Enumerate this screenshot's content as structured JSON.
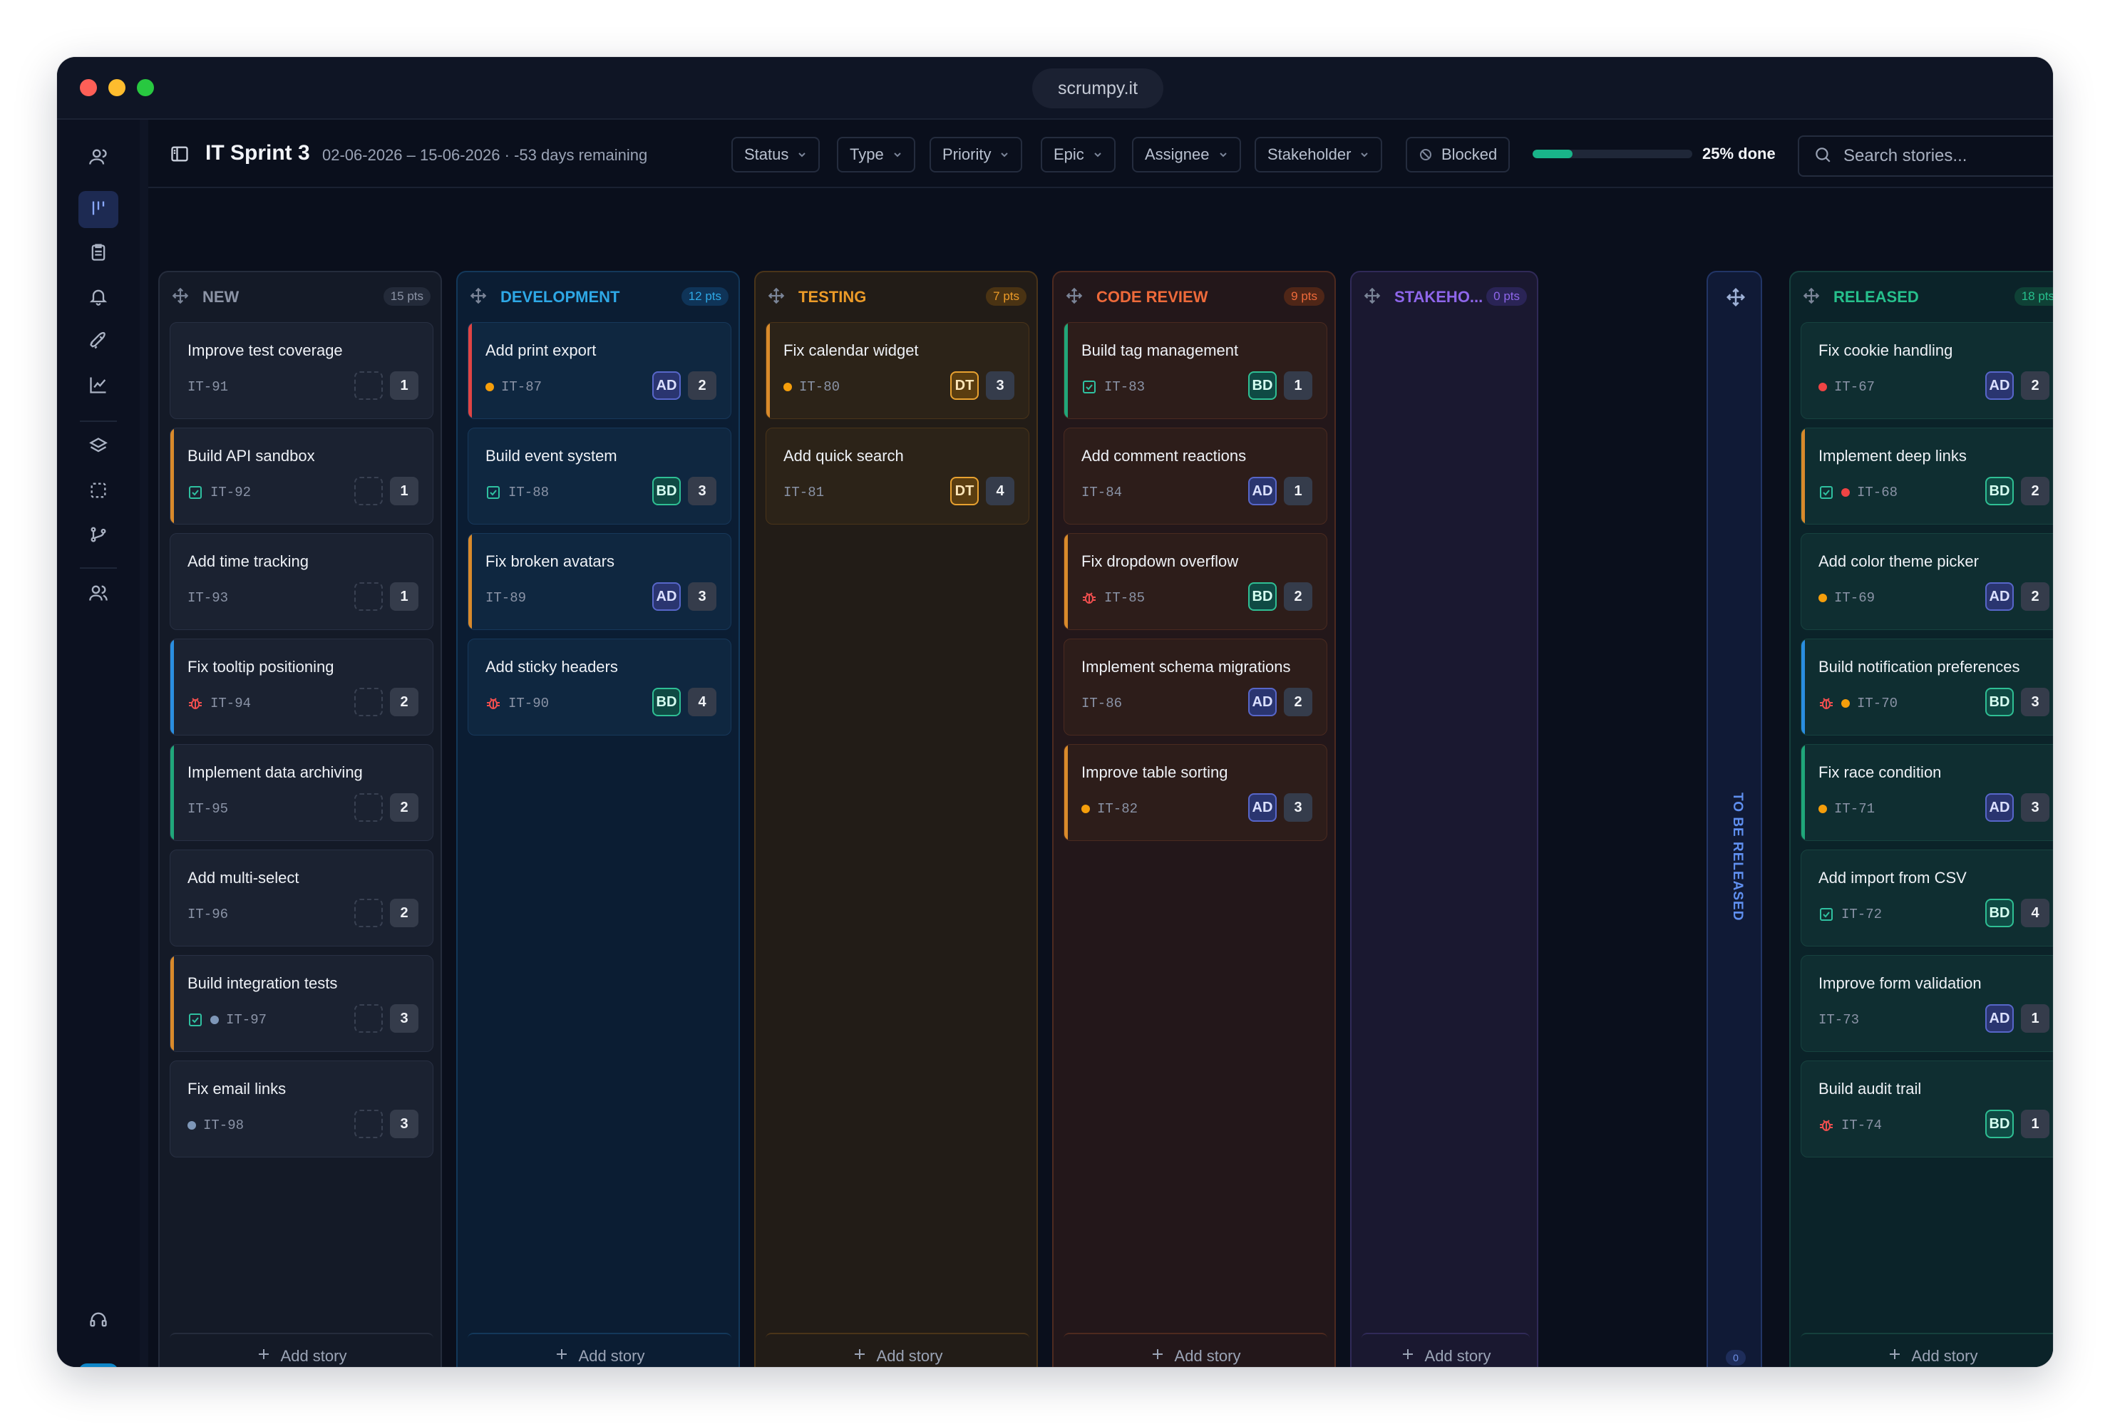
{
  "window": {
    "url": "scrumpy.it"
  },
  "user": {
    "initials": "AD"
  },
  "header": {
    "sprint_title": "IT Sprint 3",
    "sprint_dates": "02-06-2026 – 15-06-2026 · -53 days remaining",
    "filters": [
      "Status",
      "Type",
      "Priority",
      "Epic",
      "Assignee",
      "Stakeholder"
    ],
    "blocked_label": "Blocked",
    "progress_fraction": 0.25,
    "progress_label": "25% done",
    "search_placeholder": "Search stories..."
  },
  "add_story_label": "Add story",
  "colors": {
    "new": "#8b93a5",
    "development": "#2ea8e6",
    "testing": "#ec9b28",
    "code_review": "#ee6a3a",
    "stakeholder": "#8e66ea",
    "released": "#26c08c",
    "assignee_ad": "#6f7fe8",
    "assignee_bd": "#2fbf94",
    "assignee_dt": "#f0a52d",
    "priority_high": "#ef4444",
    "priority_medium": "#f59e0b",
    "priority_low": "#7e97b8"
  },
  "release_strip": {
    "label": "TO BE RELEASED",
    "count": "0"
  },
  "columns": [
    {
      "title": "NEW",
      "points": "15 pts",
      "cards": [
        {
          "title": "Improve test coverage",
          "id": "IT-91",
          "points": "1",
          "icon": "none",
          "priority": "none",
          "assignee": "",
          "accent": "none"
        },
        {
          "title": "Build API sandbox",
          "id": "IT-92",
          "points": "1",
          "icon": "task-icon",
          "priority": "none",
          "assignee": "",
          "accent": "orange"
        },
        {
          "title": "Add time tracking",
          "id": "IT-93",
          "points": "1",
          "icon": "none",
          "priority": "none",
          "assignee": "",
          "accent": "none"
        },
        {
          "title": "Fix tooltip positioning",
          "id": "IT-94",
          "points": "2",
          "icon": "bug-icon",
          "priority": "none",
          "assignee": "",
          "accent": "blue"
        },
        {
          "title": "Implement data archiving",
          "id": "IT-95",
          "points": "2",
          "icon": "none",
          "priority": "none",
          "assignee": "",
          "accent": "green"
        },
        {
          "title": "Add multi-select",
          "id": "IT-96",
          "points": "2",
          "icon": "none",
          "priority": "none",
          "assignee": "",
          "accent": "none"
        },
        {
          "title": "Build integration tests",
          "id": "IT-97",
          "points": "3",
          "icon": "task-icon",
          "priority": "low",
          "assignee": "",
          "accent": "orange"
        },
        {
          "title": "Fix email links",
          "id": "IT-98",
          "points": "3",
          "icon": "none",
          "priority": "low",
          "assignee": "",
          "accent": "none"
        }
      ]
    },
    {
      "title": "DEVELOPMENT",
      "points": "12 pts",
      "cards": [
        {
          "title": "Add print export",
          "id": "IT-87",
          "points": "2",
          "icon": "none",
          "priority": "medium",
          "assignee": "AD",
          "accent": "red"
        },
        {
          "title": "Build event system",
          "id": "IT-88",
          "points": "3",
          "icon": "task-icon",
          "priority": "none",
          "assignee": "BD",
          "accent": "none"
        },
        {
          "title": "Fix broken avatars",
          "id": "IT-89",
          "points": "3",
          "icon": "none",
          "priority": "none",
          "assignee": "AD",
          "accent": "orange"
        },
        {
          "title": "Add sticky headers",
          "id": "IT-90",
          "points": "4",
          "icon": "bug-icon",
          "priority": "none",
          "assignee": "BD",
          "accent": "none"
        }
      ]
    },
    {
      "title": "TESTING",
      "points": "7 pts",
      "cards": [
        {
          "title": "Fix calendar widget",
          "id": "IT-80",
          "points": "3",
          "icon": "none",
          "priority": "medium",
          "assignee": "DT",
          "accent": "orange"
        },
        {
          "title": "Add quick search",
          "id": "IT-81",
          "points": "4",
          "icon": "none",
          "priority": "none",
          "assignee": "DT",
          "accent": "none"
        }
      ]
    },
    {
      "title": "CODE REVIEW",
      "points": "9 pts",
      "cards": [
        {
          "title": "Build tag management",
          "id": "IT-83",
          "points": "1",
          "icon": "task-icon",
          "priority": "none",
          "assignee": "BD",
          "accent": "green"
        },
        {
          "title": "Add comment reactions",
          "id": "IT-84",
          "points": "1",
          "icon": "none",
          "priority": "none",
          "assignee": "AD",
          "accent": "none"
        },
        {
          "title": "Fix dropdown overflow",
          "id": "IT-85",
          "points": "2",
          "icon": "bug-icon",
          "priority": "none",
          "assignee": "BD",
          "accent": "orange"
        },
        {
          "title": "Implement schema migrations",
          "id": "IT-86",
          "points": "2",
          "icon": "none",
          "priority": "none",
          "assignee": "AD",
          "accent": "none"
        },
        {
          "title": "Improve table sorting",
          "id": "IT-82",
          "points": "3",
          "icon": "none",
          "priority": "medium",
          "assignee": "AD",
          "accent": "orange"
        }
      ]
    },
    {
      "title": "STAKEHO...",
      "points": "0 pts",
      "cards": []
    },
    {
      "title": "RELEASED",
      "points": "18 pts",
      "cards": [
        {
          "title": "Fix cookie handling",
          "id": "IT-67",
          "points": "2",
          "icon": "none",
          "priority": "high",
          "assignee": "AD",
          "accent": "none"
        },
        {
          "title": "Implement deep links",
          "id": "IT-68",
          "points": "2",
          "icon": "task-icon",
          "priority": "high",
          "assignee": "BD",
          "accent": "orange"
        },
        {
          "title": "Add color theme picker",
          "id": "IT-69",
          "points": "2",
          "icon": "none",
          "priority": "medium",
          "assignee": "AD",
          "accent": "none"
        },
        {
          "title": "Build notification preferences",
          "id": "IT-70",
          "points": "3",
          "icon": "bug-icon",
          "priority": "medium",
          "assignee": "BD",
          "accent": "blue"
        },
        {
          "title": "Fix race condition",
          "id": "IT-71",
          "points": "3",
          "icon": "none",
          "priority": "medium",
          "assignee": "AD",
          "accent": "green"
        },
        {
          "title": "Add import from CSV",
          "id": "IT-72",
          "points": "4",
          "icon": "task-icon",
          "priority": "none",
          "assignee": "BD",
          "accent": "none"
        },
        {
          "title": "Improve form validation",
          "id": "IT-73",
          "points": "1",
          "icon": "none",
          "priority": "none",
          "assignee": "AD",
          "accent": "none"
        },
        {
          "title": "Build audit trail",
          "id": "IT-74",
          "points": "1",
          "icon": "bug-icon",
          "priority": "none",
          "assignee": "BD",
          "accent": "none"
        }
      ]
    }
  ]
}
